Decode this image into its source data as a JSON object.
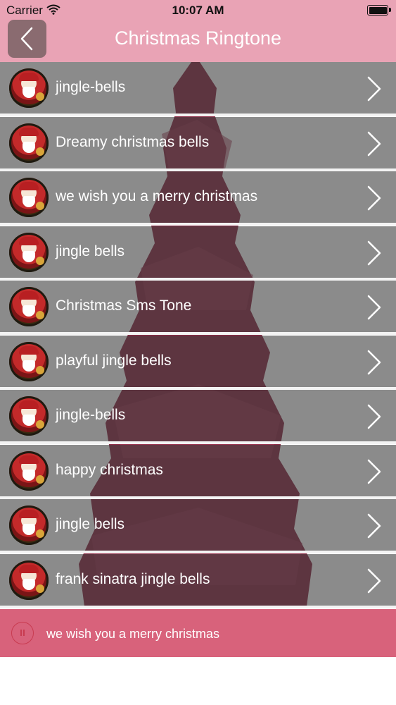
{
  "status_bar": {
    "carrier": "Carrier",
    "time": "10:07 AM"
  },
  "header": {
    "title": "Christmas Ringtone"
  },
  "ringtones": [
    {
      "label": "jingle-bells"
    },
    {
      "label": "Dreamy christmas bells"
    },
    {
      "label": "we wish you a merry christmas"
    },
    {
      "label": "jingle bells"
    },
    {
      "label": "Christmas Sms Tone"
    },
    {
      "label": "playful jingle bells"
    },
    {
      "label": "jingle-bells"
    },
    {
      "label": "happy christmas"
    },
    {
      "label": "jingle bells"
    },
    {
      "label": "frank sinatra jingle bells"
    }
  ],
  "now_playing": {
    "title": "we wish you a merry christmas",
    "state": "playing"
  },
  "icons": {
    "back": "chevron-left-icon",
    "row": "chevron-right-icon",
    "avatar": "santa-avatar",
    "player": "pause-icon"
  },
  "colors": {
    "header": "#e9a3b5",
    "player_bar": "#d8627b",
    "tree": "#8c2a45",
    "row_overlay": "#3e3e3e"
  }
}
